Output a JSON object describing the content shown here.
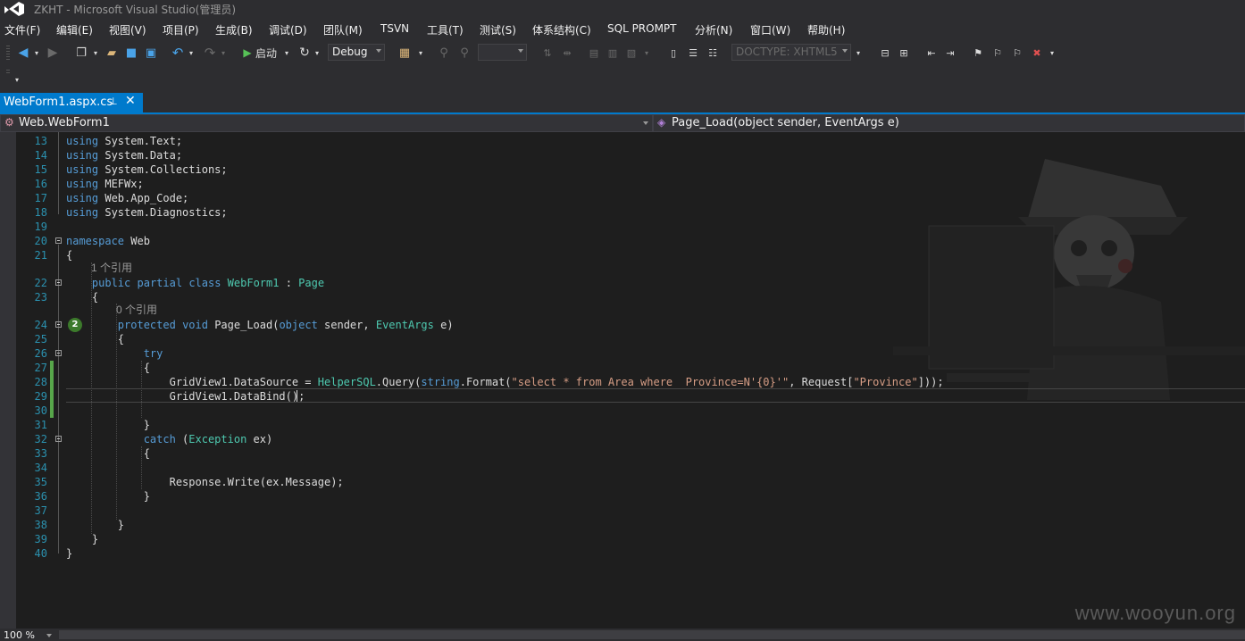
{
  "window": {
    "title": "ZKHT - Microsoft Visual Studio(管理员)"
  },
  "menu": {
    "items": [
      "文件(F)",
      "编辑(E)",
      "视图(V)",
      "项目(P)",
      "生成(B)",
      "调试(D)",
      "团队(M)",
      "TSVN",
      "工具(T)",
      "测试(S)",
      "体系结构(C)",
      "SQL PROMPT",
      "分析(N)",
      "窗口(W)",
      "帮助(H)"
    ]
  },
  "toolbar": {
    "start_label": "启动",
    "config_value": "Debug",
    "doctype_value": "DOCTYPE:  XHTML5"
  },
  "tabs": [
    {
      "label": "WebForm1.aspx.cs",
      "pin": "⊥",
      "close": "✕"
    }
  ],
  "navigation": {
    "class_combo": "Web.WebForm1",
    "member_combo": "Page_Load(object sender, EventArgs e)"
  },
  "editor": {
    "line_numbers": [
      "13",
      "14",
      "15",
      "16",
      "17",
      "18",
      "19",
      "20",
      "21",
      "22",
      "23",
      "24",
      "25",
      "26",
      "27",
      "28",
      "29",
      "30",
      "31",
      "32",
      "33",
      "34",
      "35",
      "36",
      "37",
      "38",
      "39",
      "40"
    ],
    "codelens": [
      "1 个引用",
      "0 个引用"
    ],
    "breakpoint_badge": "2",
    "lines": {
      "l13": [
        "using",
        " System.Text;"
      ],
      "l14": [
        "using",
        " System.Data;"
      ],
      "l15": [
        "using",
        " System.Collections;"
      ],
      "l16": [
        "using",
        " MEFWx;"
      ],
      "l17": [
        "using",
        " Web.App_Code;"
      ],
      "l18": [
        "using",
        " System.Diagnostics;"
      ],
      "l20": [
        "namespace",
        " Web"
      ],
      "l21": "{",
      "l22": [
        "    ",
        "public",
        " ",
        "partial",
        " ",
        "class",
        " ",
        "WebForm1",
        " : ",
        "Page"
      ],
      "l23": "    {",
      "l24": [
        "        ",
        "protected",
        " ",
        "void",
        " Page_Load(",
        "object",
        " sender, ",
        "EventArgs",
        " e)"
      ],
      "l25": "        {",
      "l26": [
        "            ",
        "try"
      ],
      "l27": "            {",
      "l28": [
        "                GridView1.DataSource = ",
        "HelperSQL",
        ".Query(",
        "string",
        ".Format(",
        "\"select * from Area where  Province=N'{0}'\"",
        ", Request[",
        "\"Province\"",
        "]));"
      ],
      "l29": "                GridView1.DataBind();",
      "l32": [
        "            ",
        "catch",
        " (",
        "Exception",
        " ex)"
      ],
      "l33": "            {",
      "l35": "                Response.Write(ex.Message);",
      "l36": "            }",
      "l31": "            }",
      "l38": "        }",
      "l39": "    }",
      "l40": "}"
    }
  },
  "watermark": "www.wooyun.org",
  "status": {
    "zoom": "100 %"
  }
}
